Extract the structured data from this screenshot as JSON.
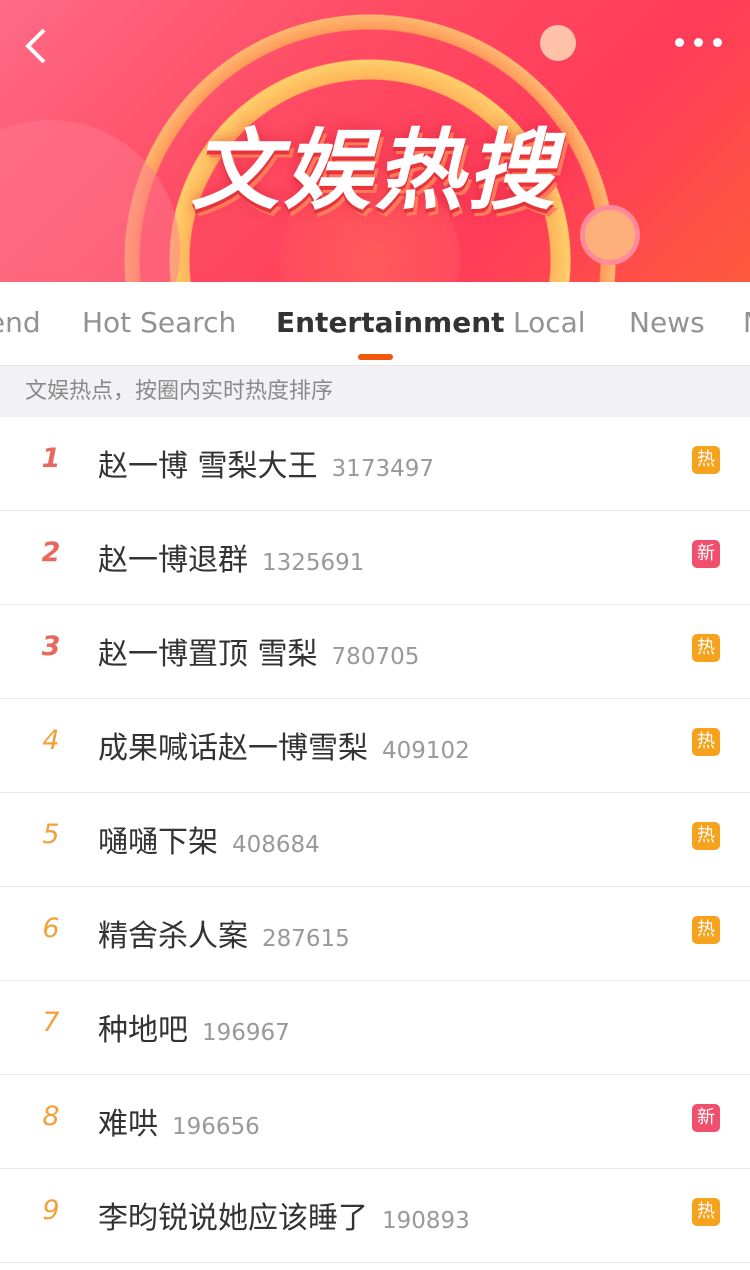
{
  "header": {
    "title": "文娱热搜",
    "back_icon": "chevron-left-icon",
    "more_icon": "more-dots-icon"
  },
  "tabs": [
    {
      "label": "Trend"
    },
    {
      "label": "Hot Search"
    },
    {
      "label": "Entertainment",
      "active": true
    },
    {
      "label": "Local"
    },
    {
      "label": "News"
    },
    {
      "label": "M"
    }
  ],
  "subheader": "文娱热点，按圈内实时热度排序",
  "colors": {
    "accent": "#f2560c",
    "hot": "#f7a21d",
    "new": "#f0506e",
    "rank_top": "#e8685c",
    "rank": "#f2a03a"
  },
  "items": [
    {
      "rank": "1",
      "title": "赵一博 雪梨大王",
      "count": "3173497",
      "badge": "热",
      "badge_type": "hot"
    },
    {
      "rank": "2",
      "title": "赵一博退群",
      "count": "1325691",
      "badge": "新",
      "badge_type": "new"
    },
    {
      "rank": "3",
      "title": "赵一博置顶 雪梨",
      "count": "780705",
      "badge": "热",
      "badge_type": "hot"
    },
    {
      "rank": "4",
      "title": "成果喊话赵一博雪梨",
      "count": "409102",
      "badge": "热",
      "badge_type": "hot"
    },
    {
      "rank": "5",
      "title": "嗵嗵下架",
      "count": "408684",
      "badge": "热",
      "badge_type": "hot"
    },
    {
      "rank": "6",
      "title": "精舍杀人案",
      "count": "287615",
      "badge": "热",
      "badge_type": "hot"
    },
    {
      "rank": "7",
      "title": "种地吧",
      "count": "196967",
      "badge": "",
      "badge_type": ""
    },
    {
      "rank": "8",
      "title": "难哄",
      "count": "196656",
      "badge": "新",
      "badge_type": "new"
    },
    {
      "rank": "9",
      "title": "李昀锐说她应该睡了",
      "count": "190893",
      "badge": "热",
      "badge_type": "hot"
    }
  ]
}
